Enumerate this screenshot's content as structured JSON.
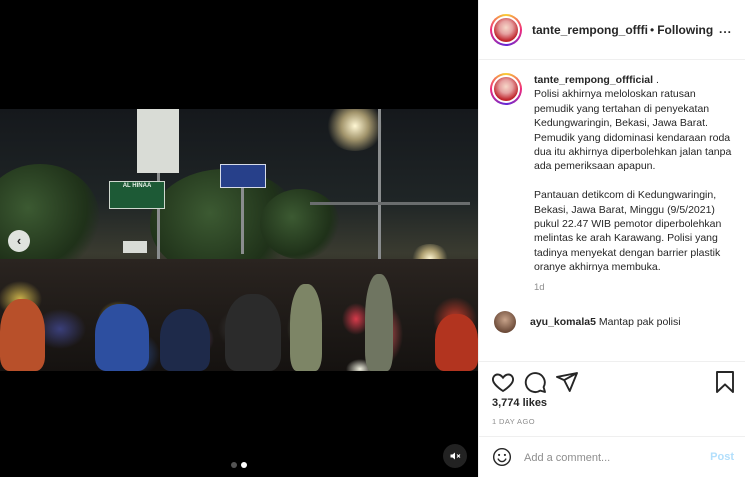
{
  "post": {
    "media": {
      "sign_green_text": "AL HINAA",
      "carousel": {
        "slides": 2,
        "active": 2
      }
    },
    "header": {
      "username": "tante_rempong_offficial",
      "separator": "•",
      "follow_status": "Following",
      "more_label": "..."
    },
    "caption": {
      "username": "tante_rempong_offficial",
      "text": " .\nPolisi akhirnya meloloskan ratusan pemudik yang tertahan di penyekatan Kedungwaringin, Bekasi, Jawa Barat. Pemudik yang didominasi kendaraan roda dua itu akhirnya diperbolehkan jalan tanpa ada pemeriksaan apapun.\n\nPantauan detikcom di Kedungwaringin, Bekasi, Jawa Barat, Minggu (9/5/2021) pukul 22.47 WIB pemotor diperbolehkan melintas ke arah Karawang. Polisi yang tadinya menyekat dengan barrier plastik oranye akhirnya membuka.",
      "time": "1d"
    },
    "first_comment": {
      "username": "ayu_komala5",
      "text": " Mantap pak polisi"
    },
    "icons": {
      "like": "heart-icon",
      "comment": "comment-bubble-icon",
      "share": "paper-plane-icon",
      "save": "bookmark-icon",
      "emoji": "smiley-icon",
      "mute": "speaker-muted-icon",
      "carousel": "chevron-left-icon"
    },
    "likes": "3,774 likes",
    "time_ago": "1 DAY AGO",
    "add_comment": {
      "placeholder": "Add a comment...",
      "post_label": "Post"
    },
    "colors": {
      "post_button_disabled": "#b2dffc",
      "secondary_text": "#8e8e8e",
      "primary_text": "#262626"
    }
  }
}
